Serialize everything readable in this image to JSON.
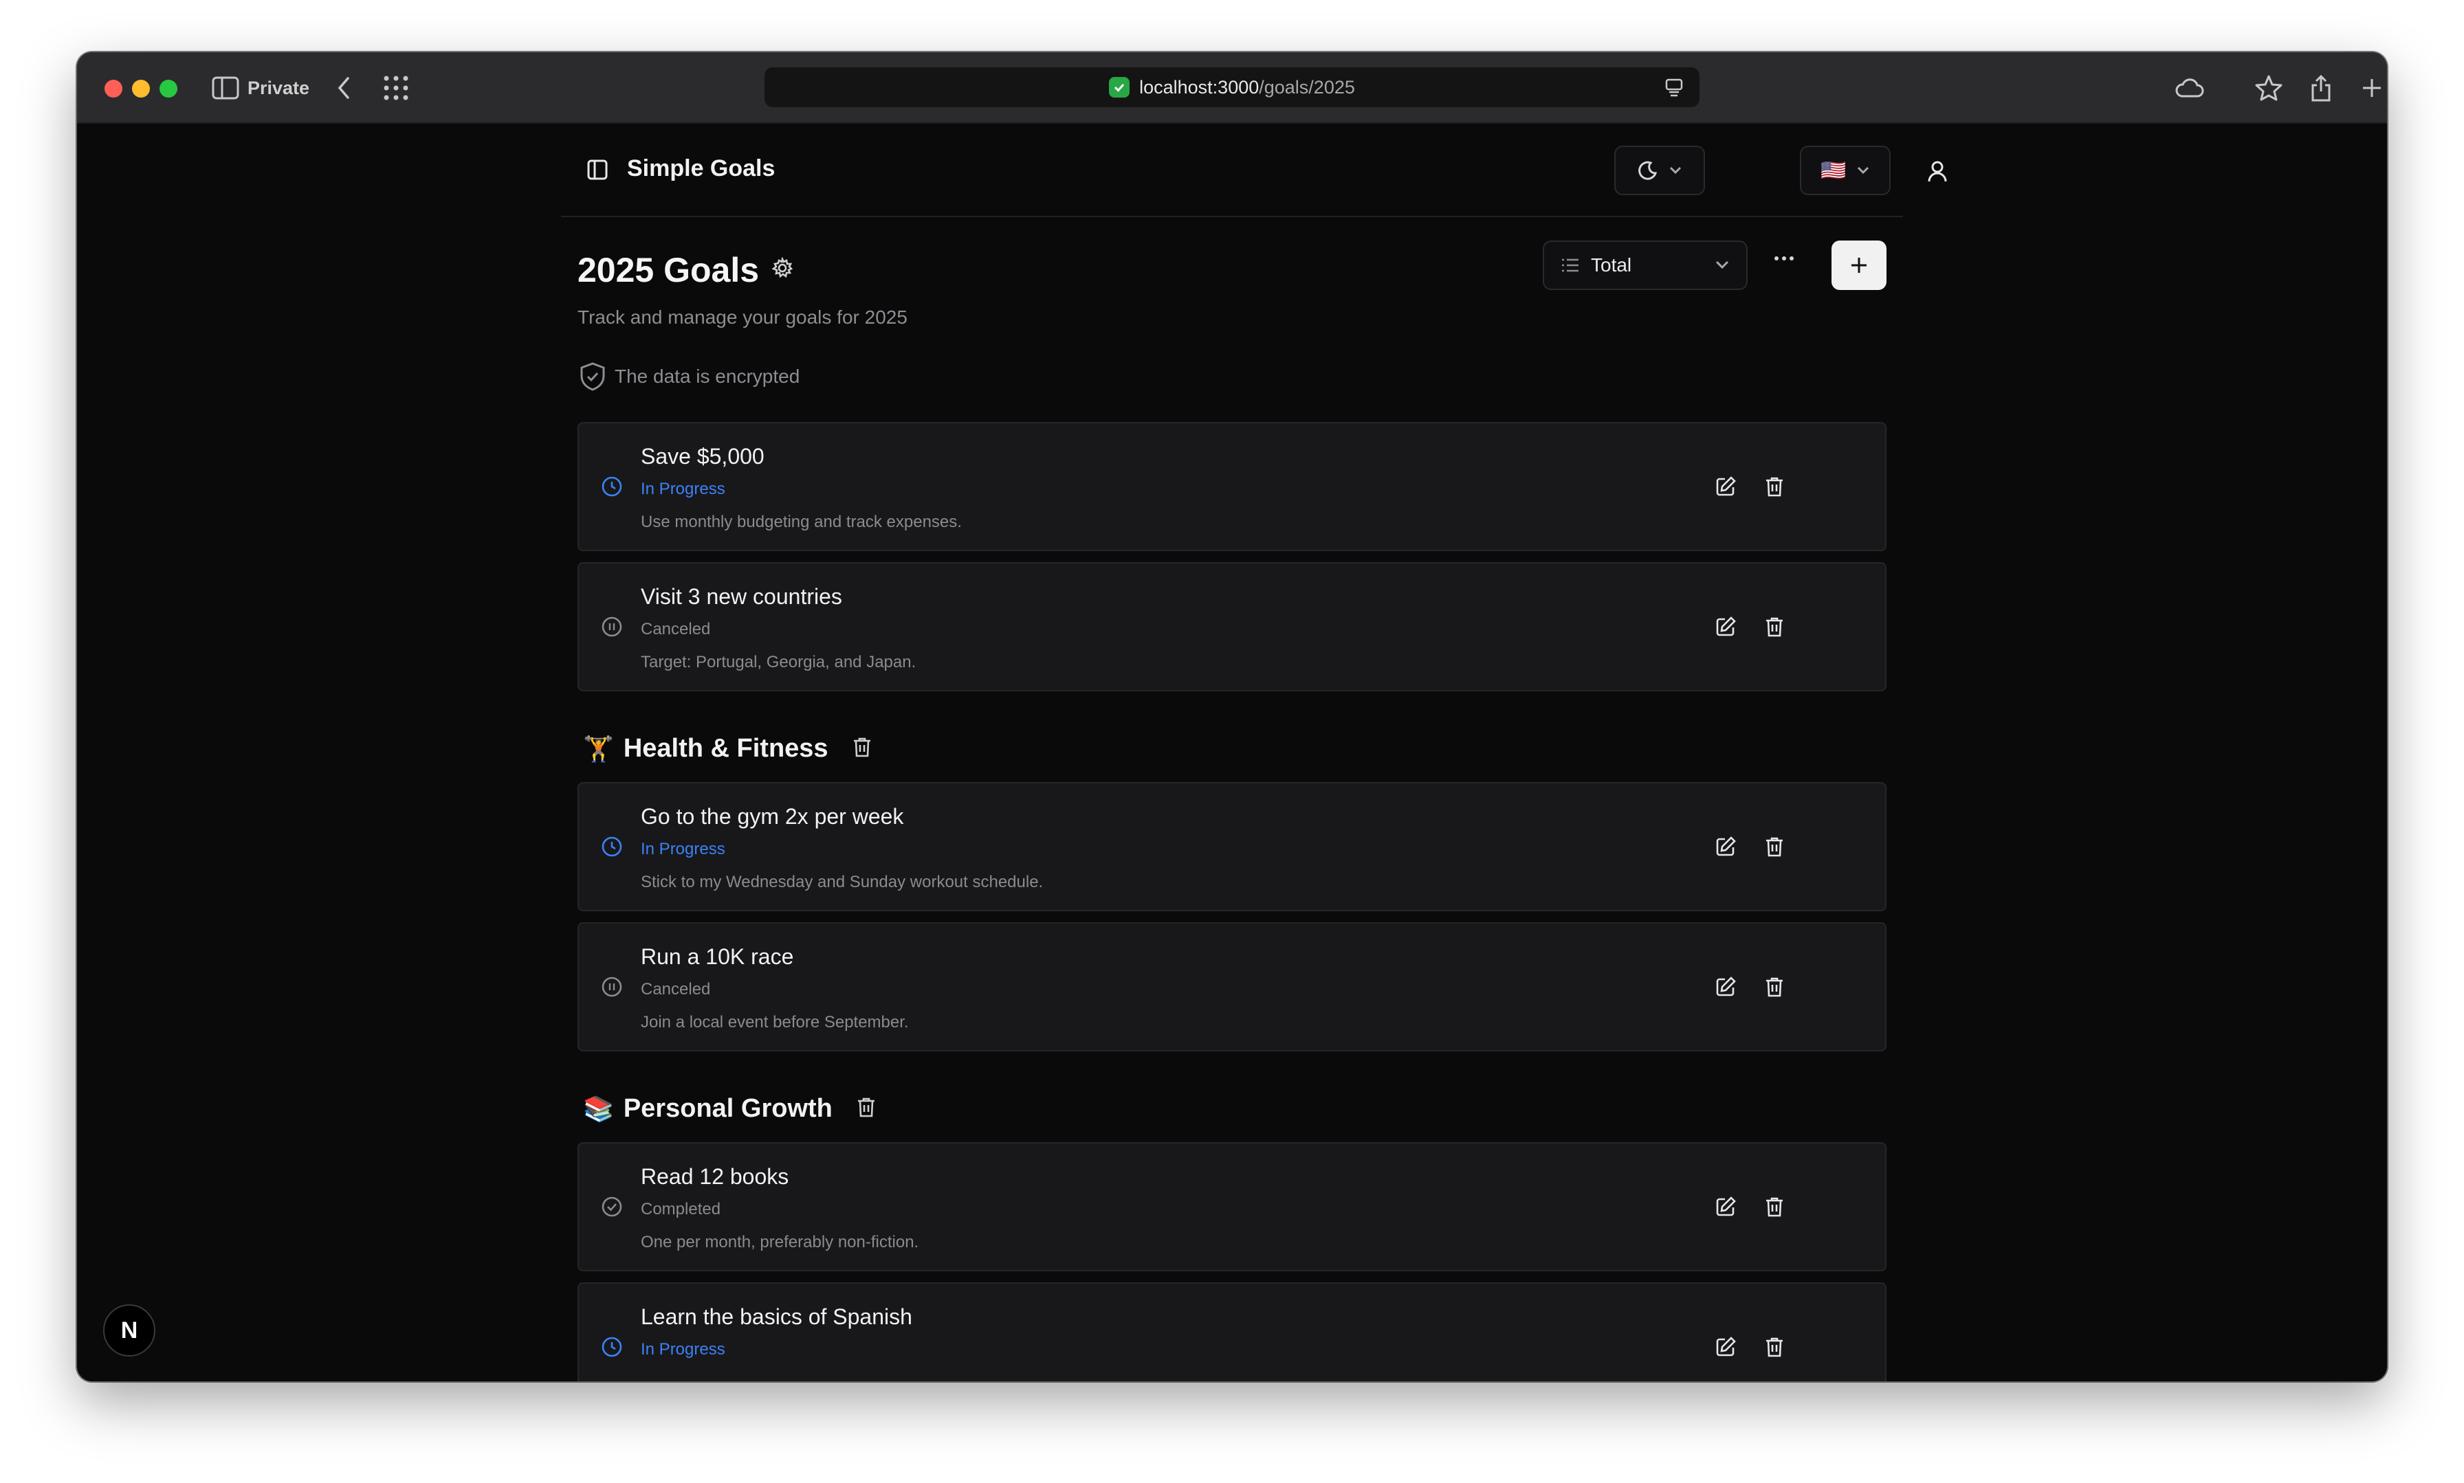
{
  "browser": {
    "private_label": "Private",
    "url_host": "localhost:3000",
    "url_path": "/goals/2025"
  },
  "app": {
    "title": "Simple Goals",
    "flag": "🇺🇸"
  },
  "page": {
    "title": "2025 Goals",
    "subtitle": "Track and manage your goals for 2025",
    "encrypted_notice": "The data is encrypted",
    "view_select": "Total"
  },
  "colors": {
    "in_progress": "#3b82f6",
    "muted": "#8a8a90"
  },
  "goals_ungrouped": [
    {
      "title": "Save $5,000",
      "status": "In Progress",
      "status_key": "in-progress",
      "description": "Use monthly budgeting and track expenses."
    },
    {
      "title": "Visit 3 new countries",
      "status": "Canceled",
      "status_key": "canceled",
      "description": "Target: Portugal, Georgia, and Japan."
    }
  ],
  "sections": [
    {
      "emoji": "🏋️",
      "title": "Health & Fitness",
      "goals": [
        {
          "title": "Go to the gym 2x per week",
          "status": "In Progress",
          "status_key": "in-progress",
          "description": "Stick to my Wednesday and Sunday workout schedule."
        },
        {
          "title": "Run a 10K race",
          "status": "Canceled",
          "status_key": "canceled",
          "description": "Join a local event before September."
        }
      ]
    },
    {
      "emoji": "📚",
      "title": "Personal Growth",
      "goals": [
        {
          "title": "Read 12 books",
          "status": "Completed",
          "status_key": "completed",
          "description": "One per month, preferably non-fiction."
        },
        {
          "title": "Learn the basics of Spanish",
          "status": "In Progress",
          "status_key": "in-progress",
          "description": ""
        }
      ]
    }
  ],
  "dev_badge": "N"
}
